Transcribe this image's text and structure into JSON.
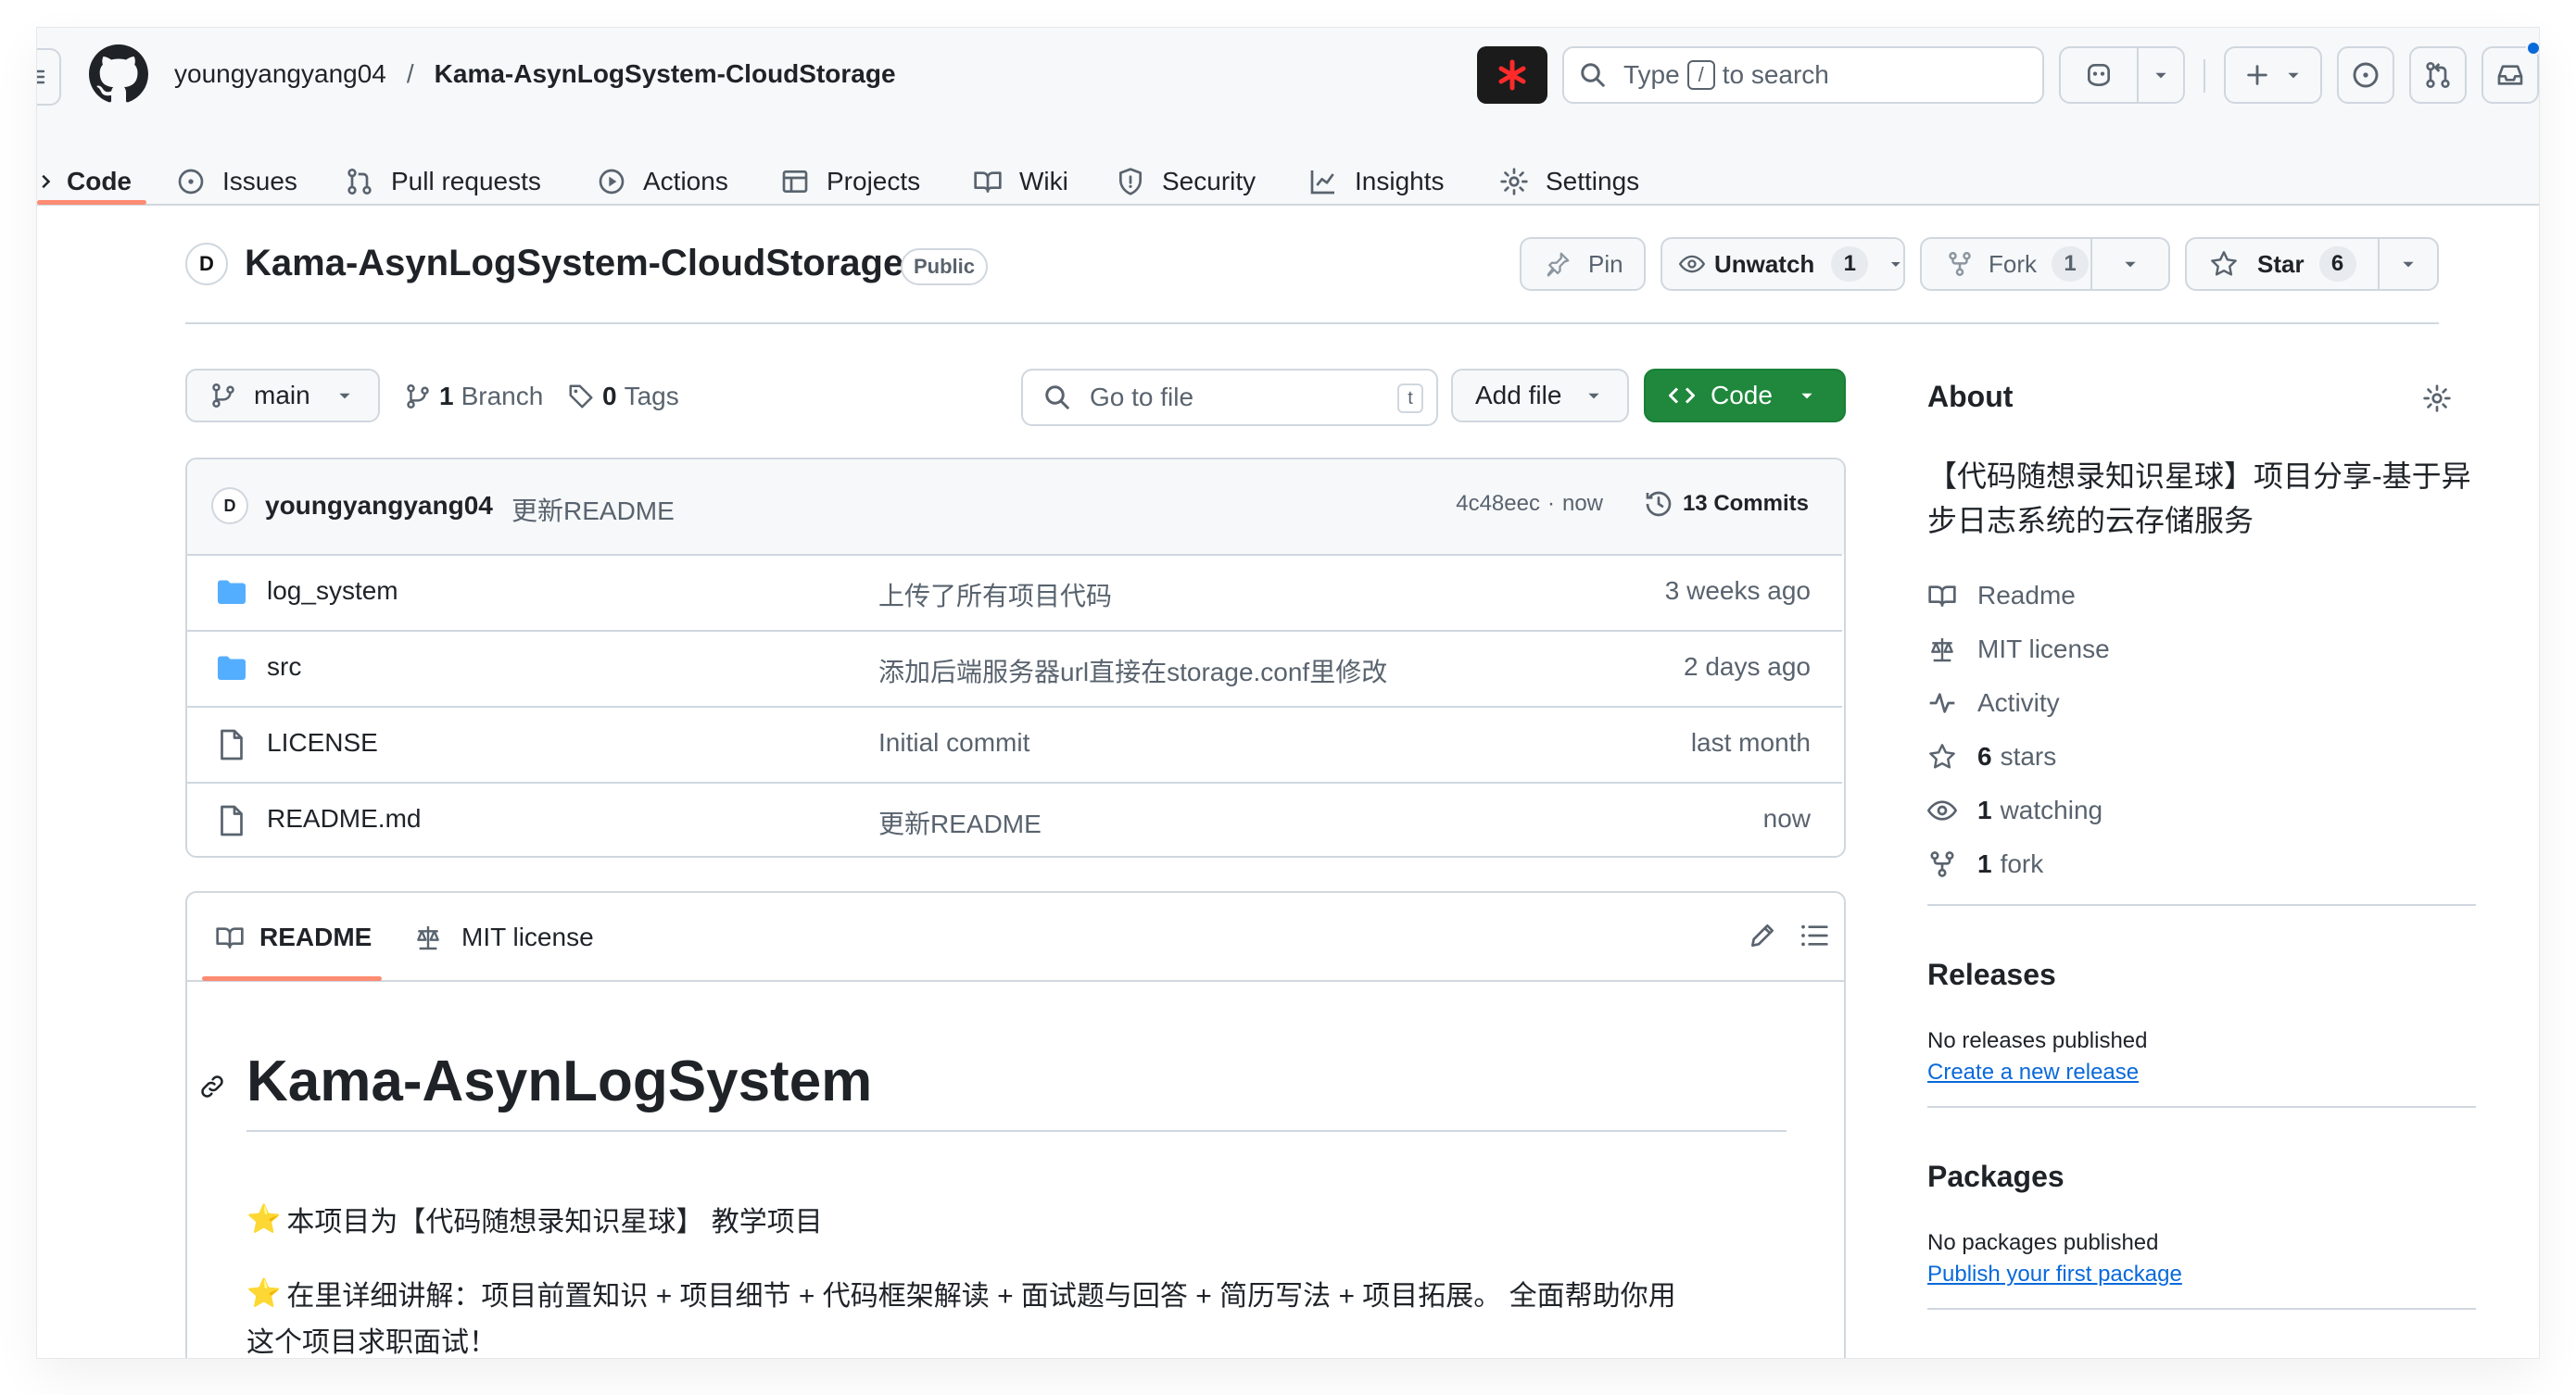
{
  "header": {
    "owner": "youngyangyang04",
    "separator": "/",
    "repo": "Kama-AsynLogSystem-CloudStorage",
    "search_text_before": "Type",
    "search_key": "/",
    "search_text_after": "to search"
  },
  "nav": {
    "tabs": [
      {
        "label": "Code",
        "icon": "code-icon",
        "active": true
      },
      {
        "label": "Issues",
        "icon": "issue-opened-icon"
      },
      {
        "label": "Pull requests",
        "icon": "git-pull-request-icon"
      },
      {
        "label": "Actions",
        "icon": "play-icon"
      },
      {
        "label": "Projects",
        "icon": "table-icon"
      },
      {
        "label": "Wiki",
        "icon": "book-icon"
      },
      {
        "label": "Security",
        "icon": "shield-icon"
      },
      {
        "label": "Insights",
        "icon": "graph-icon"
      },
      {
        "label": "Settings",
        "icon": "gear-icon"
      }
    ]
  },
  "repo": {
    "avatar_letter": "D",
    "title": "Kama-AsynLogSystem-CloudStorage",
    "visibility": "Public",
    "pin_label": "Pin",
    "unwatch_label": "Unwatch",
    "watch_count": "1",
    "fork_label": "Fork",
    "fork_count": "1",
    "star_label": "Star",
    "star_count": "6"
  },
  "toolbar": {
    "branch": "main",
    "branch_count": "1",
    "branch_label": "Branch",
    "tag_count": "0",
    "tag_label": "Tags",
    "goto_placeholder": "Go to file",
    "goto_shortcut": "t",
    "add_file_label": "Add file",
    "code_label": "Code"
  },
  "commit": {
    "author": "youngyangyang04",
    "message": "更新README",
    "hash": "4c48eec",
    "dot": "·",
    "time": "now",
    "commits_label": "13 Commits"
  },
  "files": [
    {
      "name": "log_system",
      "type": "folder",
      "message": "上传了所有项目代码",
      "time": "3 weeks ago"
    },
    {
      "name": "src",
      "type": "folder",
      "message": "添加后端服务器url直接在storage.conf里修改",
      "time": "2 days ago"
    },
    {
      "name": "LICENSE",
      "type": "file",
      "message": "Initial commit",
      "time": "last month"
    },
    {
      "name": "README.md",
      "type": "file",
      "message": "更新README",
      "time": "now"
    }
  ],
  "readme": {
    "tab_readme": "README",
    "tab_license": "MIT license",
    "heading": "Kama-AsynLogSystem",
    "star_emoji": "⭐",
    "line1": "本项目为【代码随想录知识星球】 教学项目",
    "line2": "在里详细讲解：项目前置知识 + 项目细节 + 代码框架解读 + 面试题与回答 + 简历写法 + 项目拓展。 全面帮助你用",
    "line2b": "这个项目求职面试！"
  },
  "about": {
    "title": "About",
    "description_line1": "【代码随想录知识星球】项目分享-基于异",
    "description_line2": "步日志系统的云存储服务",
    "readme": "Readme",
    "license": "MIT license",
    "activity": "Activity",
    "stars_count": "6",
    "stars_label": "stars",
    "watching_count": "1",
    "watching_label": "watching",
    "forks_count": "1",
    "forks_label": "fork"
  },
  "releases": {
    "title": "Releases",
    "none": "No releases published",
    "link": "Create a new release"
  },
  "packages": {
    "title": "Packages",
    "none": "No packages published",
    "link": "Publish your first package"
  },
  "colors": {
    "accent_active_tab": "#fd8c73",
    "primary_green": "#1f883d",
    "link_blue": "#0969da",
    "folder_blue": "#54aeff"
  }
}
